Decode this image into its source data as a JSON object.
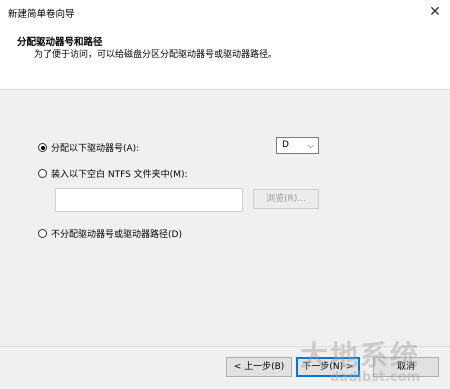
{
  "window": {
    "title": "新建简单卷向导",
    "close_glyph": "✕"
  },
  "header": {
    "title": "分配驱动器号和路径",
    "subtitle": "为了便于访问，可以给磁盘分区分配驱动器号或驱动器路径。"
  },
  "options": {
    "assign_letter_label": "分配以下驱动器号(A):",
    "drive_letter_value": "D",
    "mount_folder_label": "装入以下空白 NTFS 文件夹中(M):",
    "browse_label": "浏览(R)...",
    "no_assign_label": "不分配驱动器号或驱动器路径(D)"
  },
  "footer": {
    "back_label": "< 上一步(B)",
    "next_label": "下一步(N) >",
    "cancel_label": "取消"
  },
  "watermark": {
    "main": "大地系统",
    "sub": "dadibst.com"
  }
}
